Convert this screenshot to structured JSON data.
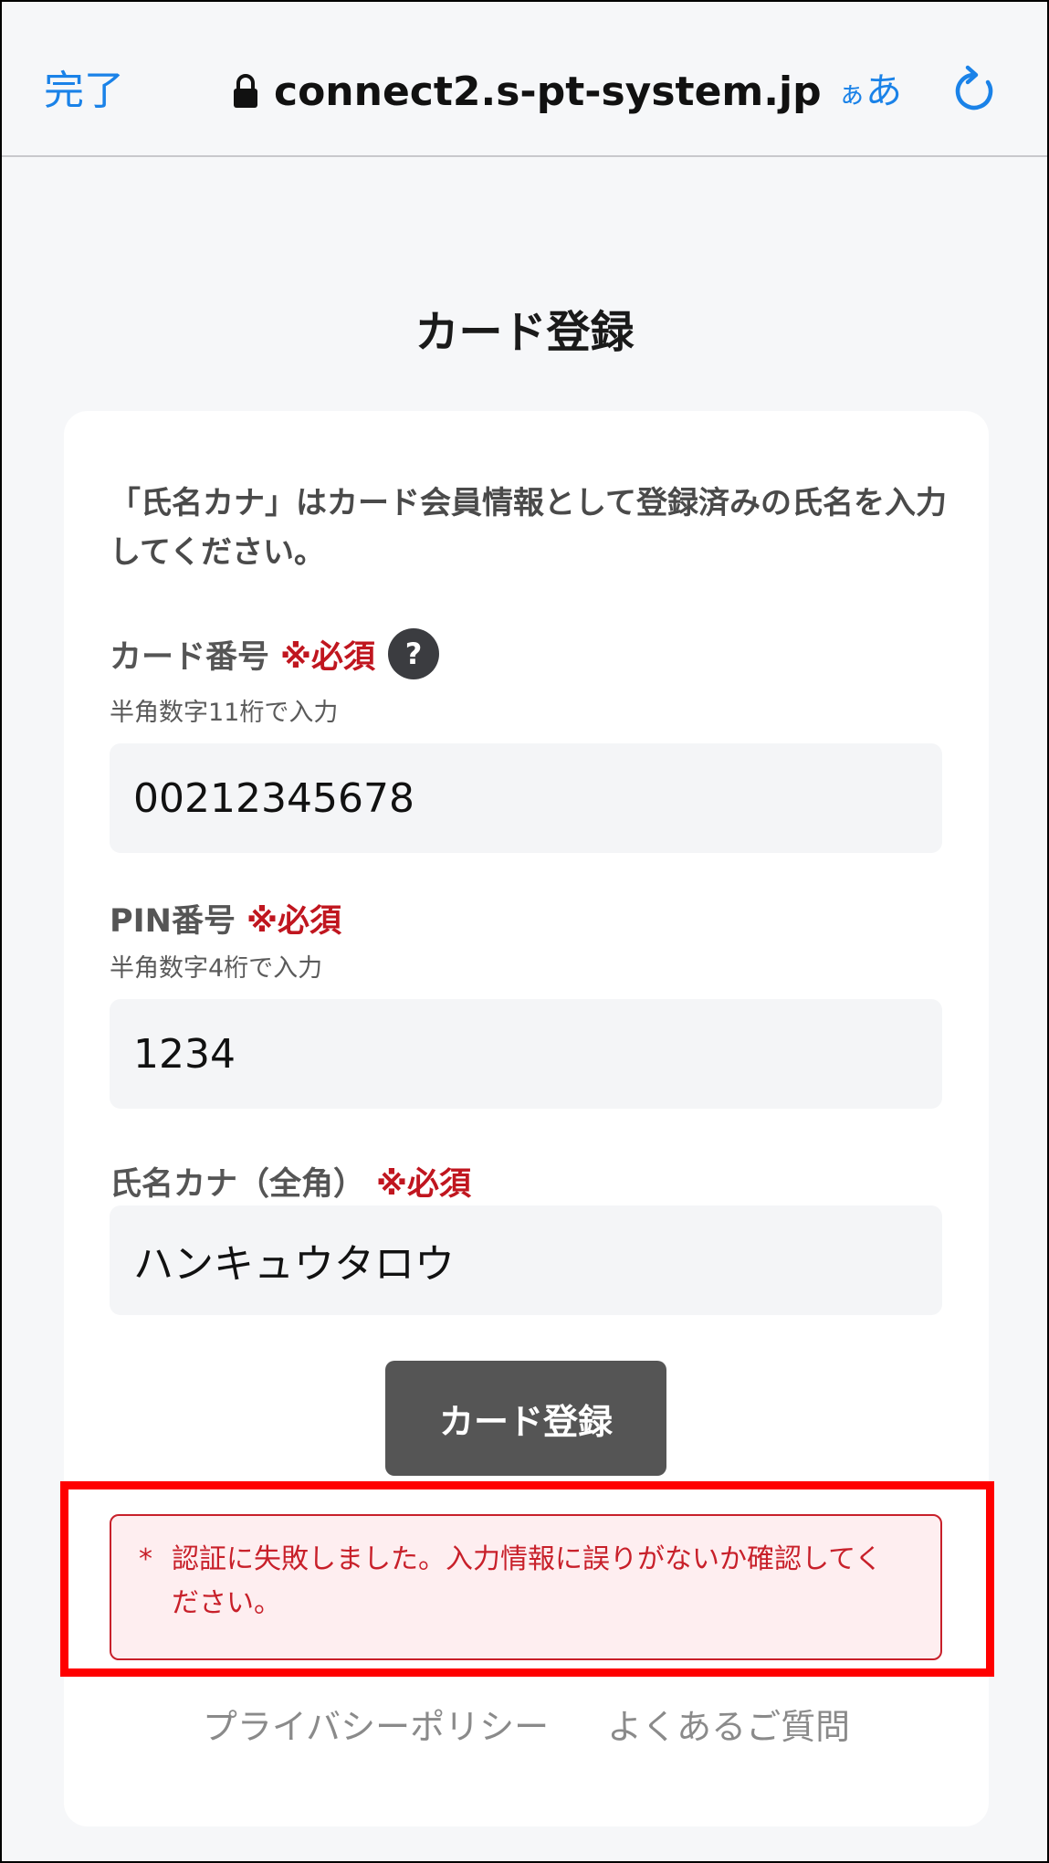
{
  "browser": {
    "done_label": "完了",
    "url": "connect2.s-pt-system.jp",
    "text_size_label_small": "ぁ",
    "text_size_label": "あ",
    "icons": [
      "lock-icon",
      "reload-icon"
    ],
    "accent_color": "#1a82e8"
  },
  "page": {
    "title": "カード登録"
  },
  "form": {
    "intro": "「氏名カナ」はカード会員情報として登録済みの氏名を入力してください。",
    "required_mark": "※必須",
    "required_color": "#c0161f",
    "card_number": {
      "label": "カード番号",
      "hint": "半角数字11桁で入力",
      "value": "00212345678",
      "help_icon": "?"
    },
    "pin": {
      "label": "PIN番号",
      "hint": "半角数字4桁で入力",
      "value": "1234"
    },
    "name_kana": {
      "label": "氏名カナ（全角）",
      "value": "ハンキュウタロウ"
    },
    "submit_label": "カード登録"
  },
  "error": {
    "marker": "*",
    "message": "認証に失敗しました。入力情報に誤りがないか確認してください。",
    "color": "#c8202a",
    "highlight_color": "#ff0000"
  },
  "footer": {
    "privacy_label": "プライバシーポリシー",
    "faq_label": "よくあるご質問"
  }
}
